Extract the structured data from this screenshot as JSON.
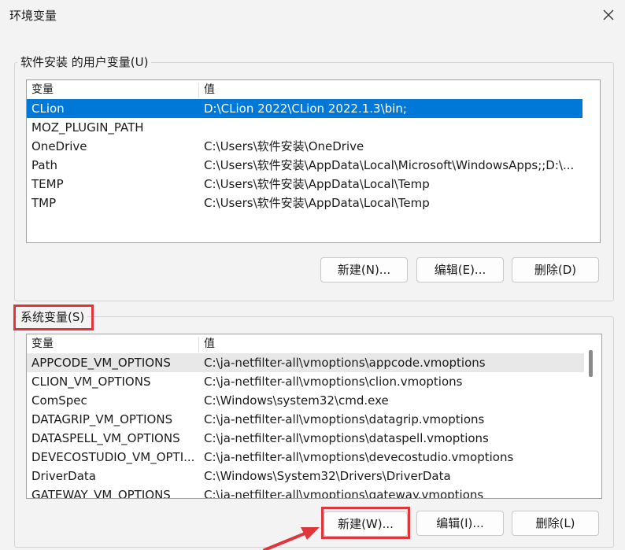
{
  "window": {
    "title": "环境变量"
  },
  "user_vars": {
    "label": "软件安装 的用户变量(U)",
    "columns": [
      "变量",
      "值"
    ],
    "rows": [
      {
        "name": "CLion",
        "value": "D:\\CLion 2022\\CLion 2022.1.3\\bin;"
      },
      {
        "name": "MOZ_PLUGIN_PATH",
        "value": ""
      },
      {
        "name": "OneDrive",
        "value": "C:\\Users\\软件安装\\OneDrive"
      },
      {
        "name": "Path",
        "value": "C:\\Users\\软件安装\\AppData\\Local\\Microsoft\\WindowsApps;;D:\\..."
      },
      {
        "name": "TEMP",
        "value": "C:\\Users\\软件安装\\AppData\\Local\\Temp"
      },
      {
        "name": "TMP",
        "value": "C:\\Users\\软件安装\\AppData\\Local\\Temp"
      }
    ],
    "selected_row": "CLion",
    "buttons": {
      "new": "新建(N)...",
      "edit": "编辑(E)...",
      "delete": "删除(D)"
    }
  },
  "system_vars": {
    "label": "系统变量(S)",
    "columns": [
      "变量",
      "值"
    ],
    "rows": [
      {
        "name": "APPCODE_VM_OPTIONS",
        "value": "C:\\ja-netfilter-all\\vmoptions\\appcode.vmoptions"
      },
      {
        "name": "CLION_VM_OPTIONS",
        "value": "C:\\ja-netfilter-all\\vmoptions\\clion.vmoptions"
      },
      {
        "name": "ComSpec",
        "value": "C:\\Windows\\system32\\cmd.exe"
      },
      {
        "name": "DATAGRIP_VM_OPTIONS",
        "value": "C:\\ja-netfilter-all\\vmoptions\\datagrip.vmoptions"
      },
      {
        "name": "DATASPELL_VM_OPTIONS",
        "value": "C:\\ja-netfilter-all\\vmoptions\\dataspell.vmoptions"
      },
      {
        "name": "DEVECOSTUDIO_VM_OPTI...",
        "value": "C:\\ja-netfilter-all\\vmoptions\\devecostudio.vmoptions"
      },
      {
        "name": "DriverData",
        "value": "C:\\Windows\\System32\\Drivers\\DriverData"
      },
      {
        "name": "GATEWAY_VM_OPTIONS",
        "value": "C:\\ja-netfilter-all\\vmoptions\\gateway.vmoptions"
      }
    ],
    "hovered_row": "APPCODE_VM_OPTIONS",
    "buttons": {
      "new": "新建(W)...",
      "edit": "编辑(I)...",
      "delete": "删除(L)"
    }
  },
  "colors": {
    "selection": "#0078d7",
    "annotation": "#e0353a"
  },
  "icons": {
    "close": "close-icon"
  }
}
